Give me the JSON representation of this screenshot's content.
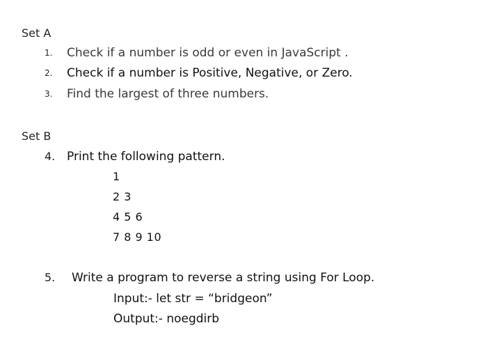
{
  "set_a": {
    "heading": "Set A",
    "items": [
      {
        "number": "1.",
        "text": "Check if a number is odd or even in JavaScript ."
      },
      {
        "number": "2.",
        "text": "Check if a number is Positive, Negative, or Zero."
      },
      {
        "number": "3.",
        "text": "Find the largest of three numbers."
      }
    ]
  },
  "set_b": {
    "heading": "Set B",
    "item4": {
      "number": "4.",
      "text": "Print the following pattern.",
      "pattern": [
        "1",
        "2 3",
        "4 5 6",
        "7 8 9 10"
      ]
    },
    "item5": {
      "number": "5.",
      "text": "Write a program to reverse a string using For Loop.",
      "input_line": "Input:- let str = “bridgeon”",
      "output_line": "Output:- noegdirb"
    }
  }
}
